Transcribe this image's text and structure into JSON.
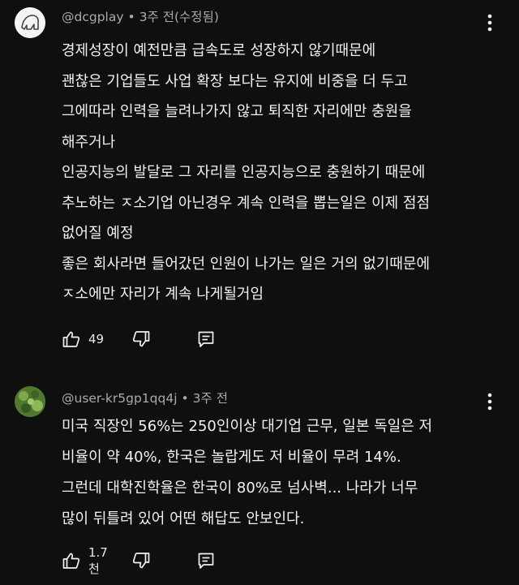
{
  "comments": [
    {
      "author": "@dcgplay",
      "separator": "•",
      "time": "3주 전(수정됨)",
      "avatar_color": "#f4f4f4",
      "lines": [
        "경제성장이 예전만큼 급속도로 성장하지 않기때문에",
        "괜찮은 기업들도 사업 확장 보다는 유지에 비중을 더 두고",
        "그에따라 인력을 늘려나가지 않고 퇴직한 자리에만 충원을",
        "해주거나",
        "인공지능의 발달로 그 자리를 인공지능으로 충원하기 때문에",
        "추노하는 ㅈ소기업 아닌경우 계속 인력을 뽑는일은 이제 점점",
        "없어질 예정",
        "좋은 회사라면 들어갔던 인원이 나가는 일은 거의 없기때문에",
        "ㅈ소에만 자리가 계속 나게될거임"
      ],
      "likes": "49",
      "icons": {
        "like": "thumb-up-icon",
        "dislike": "thumb-down-icon",
        "reply": "reply-icon",
        "more": "more-vert-icon"
      }
    },
    {
      "author": "@user-kr5gp1qq4j",
      "separator": "•",
      "time": "3주 전",
      "avatar_color": "#4f7a2c",
      "lines": [
        "미국 직장인 56%는 250인이상 대기업 근무, 일본 독일은 저",
        "비율이 약 40%, 한국은 놀랍게도 저 비율이  무려 14%.",
        "그런데 대학진학율은 한국이 80%로 넘사벽... 나라가 너무",
        "많이 뒤틀려 있어 어떤 해답도 안보인다."
      ],
      "likes": "1.7천",
      "icons": {
        "like": "thumb-up-icon",
        "dislike": "thumb-down-icon",
        "reply": "reply-icon",
        "more": "more-vert-icon"
      }
    }
  ],
  "colors": {
    "background": "#0f0f0f",
    "text": "#f1f1f1",
    "meta": "#aaaaaa"
  }
}
